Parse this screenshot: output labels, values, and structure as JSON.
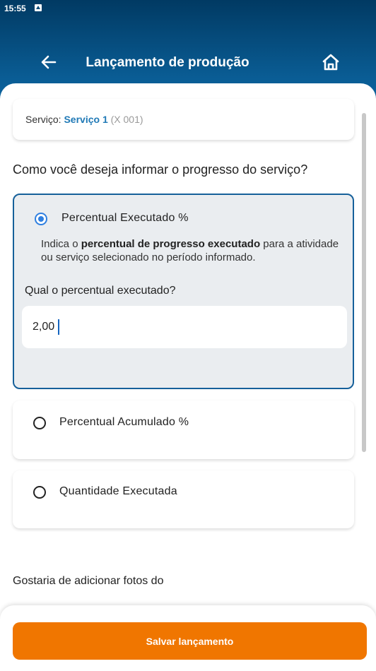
{
  "status_bar": {
    "time": "15:55",
    "notification_icon": "android-notification-icon"
  },
  "header": {
    "title": "Lançamento de produção",
    "back_icon": "arrow-left-icon",
    "home_icon": "home-icon"
  },
  "service": {
    "label": "Serviço:",
    "name": "Serviço 1",
    "code": "(X  001)"
  },
  "question": "Como você deseja informar o progresso do serviço?",
  "options": [
    {
      "label": "Percentual Executado %",
      "selected": true,
      "description_pre": "Indica o ",
      "description_bold": "percentual de progresso executado",
      "description_post": " para a atividade ou serviço selecionado no período informado.",
      "input_question": "Qual o percentual executado?",
      "input_value": "2,00"
    },
    {
      "label": "Percentual Acumulado %",
      "selected": false
    },
    {
      "label": "Quantidade Executada",
      "selected": false
    }
  ],
  "photos_question": "Gostaria de adicionar fotos do",
  "save_button": "Salvar lançamento",
  "colors": {
    "accent": "#f07600",
    "header": "#0a5d95",
    "link": "#1f79b6",
    "radio": "#2f7fe0"
  }
}
